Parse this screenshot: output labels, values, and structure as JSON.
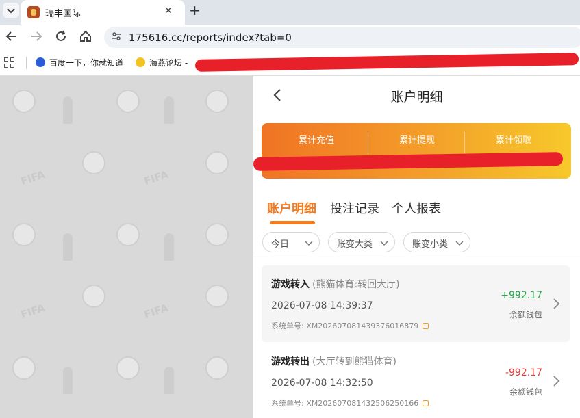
{
  "browser": {
    "tab_title": "瑞丰国际",
    "tab_close": "✕",
    "new_tab": "+",
    "url": "175616.cc/reports/index?tab=0",
    "bookmarks": [
      {
        "label": "百度一下，你就知道"
      },
      {
        "label": "海燕论坛 -"
      }
    ]
  },
  "page": {
    "title": "账户明细",
    "summary": {
      "items": [
        {
          "label": "累计充值"
        },
        {
          "label": "累计提现"
        },
        {
          "label": "累计领取"
        }
      ]
    },
    "tabs": [
      {
        "label": "账户明细",
        "active": true
      },
      {
        "label": "投注记录",
        "active": false
      },
      {
        "label": "个人报表",
        "active": false
      }
    ],
    "filters": [
      {
        "label": "今日"
      },
      {
        "label": "账变大类"
      },
      {
        "label": "账变小类"
      }
    ],
    "records": [
      {
        "type": "游戏转入",
        "detail": "(熊猫体育:转回大厅)",
        "time": "2026-07-08 14:39:37",
        "order_label": "系统单号:",
        "order_no": "XM202607081439376016879",
        "amount": "+992.17",
        "wallet": "余额钱包"
      },
      {
        "type": "游戏转出",
        "detail": "(大厅转到熊猫体育)",
        "time": "2026-07-08 14:32:50",
        "order_label": "系统单号:",
        "order_no": "XM202607081432506250166",
        "amount": "-992.17",
        "wallet": "余额钱包"
      }
    ]
  },
  "colors": {
    "accent": "#f47b20",
    "positive": "#2ba24c",
    "negative": "#e53935",
    "redaction": "#e8202a"
  }
}
